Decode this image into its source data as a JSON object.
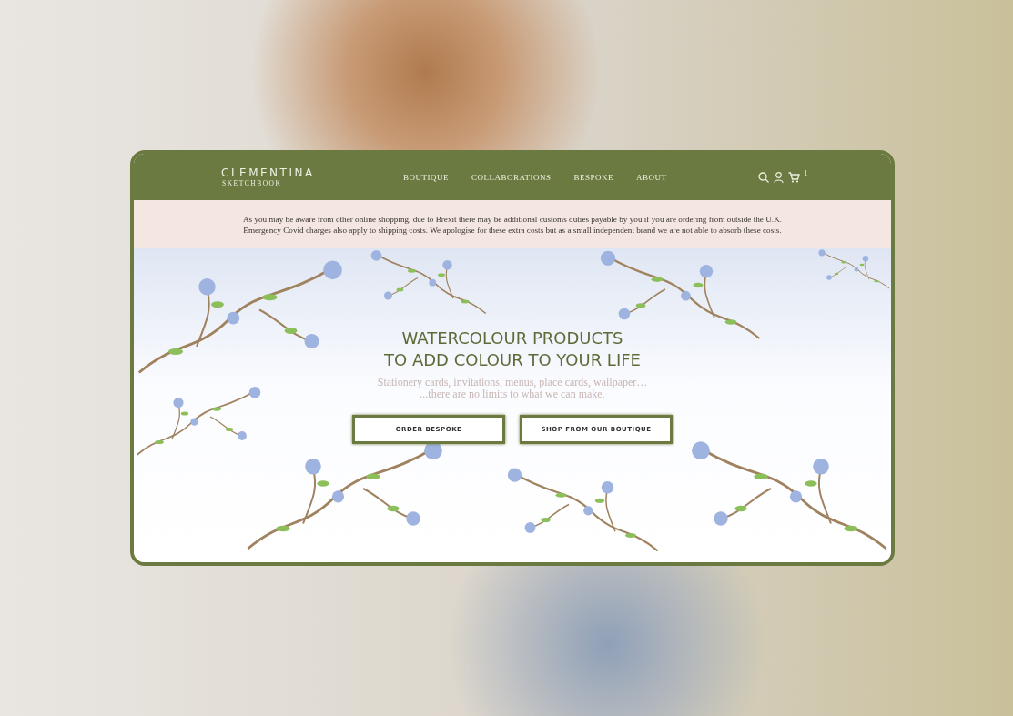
{
  "brand": {
    "name": "CLEMENTINA",
    "tagline": "SKETCHBOOK"
  },
  "nav": [
    {
      "label": "BOUTIQUE"
    },
    {
      "label": "COLLABORATIONS"
    },
    {
      "label": "BESPOKE"
    },
    {
      "label": "ABOUT"
    }
  ],
  "cart_count": "1",
  "notice": [
    "As you may be aware from other online shopping, due to Brexit there may be additional customs duties payable by you if you are ordering from outside the U.K.",
    "Emergency Covid charges also apply to shipping costs. We apologise for these extra costs but as a small independent brand we are not able to absorb these costs."
  ],
  "hero": {
    "title": [
      "WATERCOLOUR PRODUCTS",
      "TO ADD COLOUR TO YOUR LIFE"
    ],
    "subtitle": [
      "Stationery cards, invitations, menus, place cards, wallpaper…",
      "...there are no limits to what we can make."
    ],
    "buttons": [
      {
        "label": "ORDER BESPOKE"
      },
      {
        "label": "SHOP FROM OUR BOUTIQUE"
      }
    ]
  }
}
